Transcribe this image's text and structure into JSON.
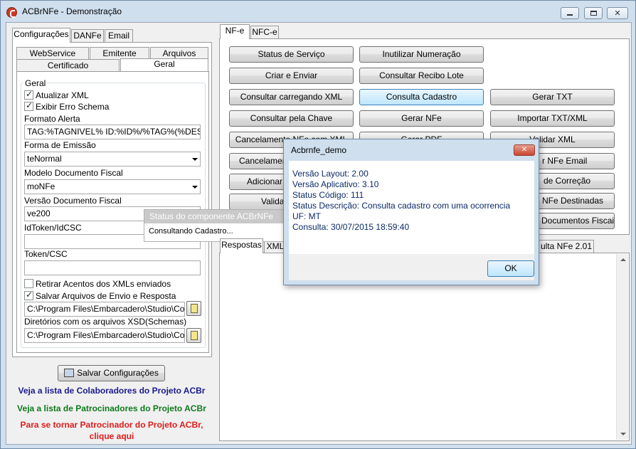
{
  "window": {
    "title": "ACBrNFe - Demonstração"
  },
  "left_tabs": {
    "row1": [
      "Configurações",
      "DANFe",
      "Email"
    ]
  },
  "config_tabs": {
    "row_top": [
      "WebService",
      "Emitente",
      "Arquivos"
    ],
    "row_bottom": [
      "Certificado",
      "Geral"
    ]
  },
  "geral": {
    "group_label": "Geral",
    "atualizar_xml": "Atualizar XML",
    "exibir_erro": "Exibir Erro Schema",
    "formato_alerta_label": "Formato Alerta",
    "formato_alerta_value": "TAG:%TAGNIVEL% ID:%ID%/%TAG%(%DESCRICA",
    "forma_emissao_label": "Forma de Emissão",
    "forma_emissao_value": "teNormal",
    "modelo_label": "Modelo Documento Fiscal",
    "modelo_value": "moNFe",
    "versao_label": "Versão Documento Fiscal",
    "versao_value": "ve200",
    "idtoken_label": "IdToken/IdCSC",
    "token_label": "Token/CSC",
    "retirar_acentos": "Retirar Acentos dos XMLs enviados",
    "salvar_arquivos": "Salvar Arquivos de Envio e Resposta",
    "path1": "C:\\Program Files\\Embarcadero\\Studio\\Compor",
    "dir_label": "Diretórios com os arquivos XSD(Schemas)",
    "path2": "C:\\Program Files\\Embarcadero\\Studio\\Compor"
  },
  "save_button": "Salvar Configurações",
  "links": {
    "colaboradores": "Veja a lista de Colaboradores do Projeto ACBr",
    "patrocinadores": "Veja a lista de Patrocinadores do Projeto ACBr",
    "tornar_line1": "Para se tornar Patrocinador do Projeto ACBr,",
    "tornar_line2": "clique aqui"
  },
  "right_tabs": [
    "NF-e",
    "NFC-e"
  ],
  "buttons": {
    "col1": [
      "Status de Serviço",
      "Criar e Enviar",
      "Consultar carregando XML",
      "Consultar pela Chave",
      "Cancelamento NFe com XML",
      "Cancelamento",
      "Adicionar r",
      "Valida"
    ],
    "col2": [
      "Inutilizar Numeração",
      "Consultar Recibo Lote",
      "Consulta Cadastro",
      "Gerar NFe",
      "Gerar PDF"
    ],
    "col3": [
      "Gerar TXT",
      "Importar TXT/XML",
      "Validar XML",
      "r NFe Email",
      "de Correção",
      "NFe Destinadas",
      "Documentos Fiscais"
    ]
  },
  "bottom_tabs": [
    "Respostas",
    "XML",
    "ulta NFe 2.01"
  ],
  "status_popup": {
    "title": "Status do componente ACBrNFe",
    "message": "Consultando Cadastro..."
  },
  "dialog": {
    "title": "Acbrnfe_demo",
    "lines": [
      "Versão Layout: 2.00",
      "Versão Aplicativo: 3.10",
      "Status Código: 111",
      "Status Descrição: Consulta cadastro com uma ocorrencia",
      "UF: MT",
      "Consulta: 30/07/2015 18:59:40"
    ],
    "ok": "OK"
  }
}
